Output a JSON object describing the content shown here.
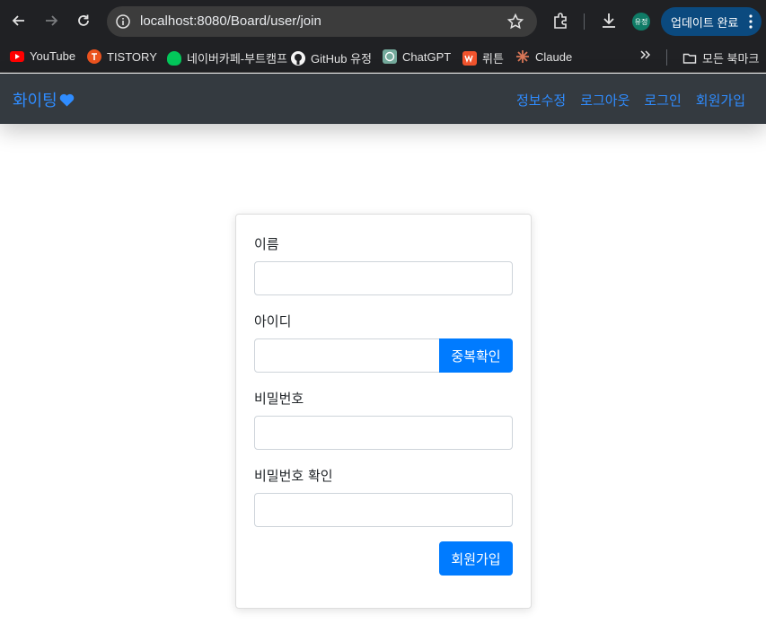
{
  "browser": {
    "url": "localhost:8080/Board/user/join",
    "profile_label": "유정",
    "update_label": "업데이트 완료",
    "bookmarks": [
      {
        "label": "YouTube",
        "icon": "youtube-icon"
      },
      {
        "label": "TISTORY",
        "icon": "tistory-icon"
      },
      {
        "label": "네이버카페-부트캠프",
        "icon": "naver-cafe-icon"
      },
      {
        "label": "GitHub 유정",
        "icon": "github-icon"
      },
      {
        "label": "ChatGPT",
        "icon": "chatgpt-icon"
      },
      {
        "label": "뤼튼",
        "icon": "wrtn-icon"
      },
      {
        "label": "Claude",
        "icon": "claude-icon"
      }
    ],
    "all_bookmarks_label": "모든 북마크"
  },
  "site": {
    "brand": "화이팅",
    "nav": [
      "정보수정",
      "로그아웃",
      "로그인",
      "회원가입"
    ],
    "accent": "#007bff"
  },
  "form": {
    "name_label": "이름",
    "id_label": "아이디",
    "check_button": "중복확인",
    "password_label": "비밀번호",
    "password_confirm_label": "비밀번호 확인",
    "submit_button": "회원가입"
  }
}
